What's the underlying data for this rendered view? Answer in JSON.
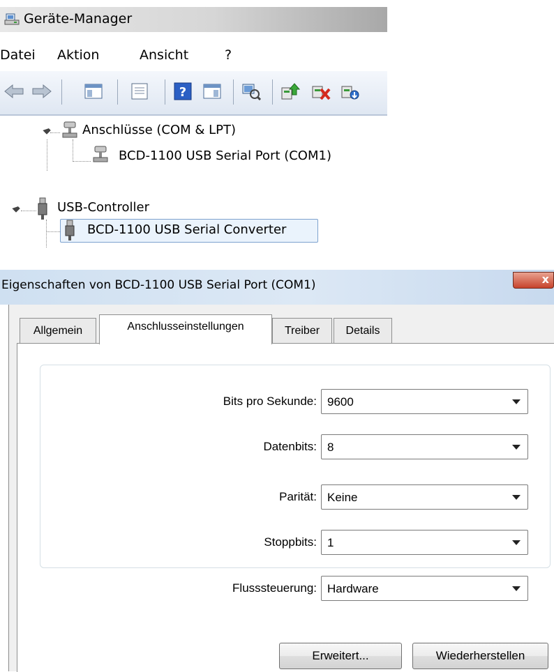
{
  "device_manager": {
    "title": "Geräte-Manager",
    "menu": [
      "Datei",
      "Aktion",
      "Ansicht",
      "?"
    ],
    "toolbar": [
      {
        "name": "back-icon"
      },
      {
        "name": "forward-icon"
      },
      {
        "name": "show-hide-console-tree-icon"
      },
      {
        "name": "properties-icon"
      },
      {
        "name": "help-icon"
      },
      {
        "name": "action-pane-icon"
      },
      {
        "name": "scan-hardware-icon"
      },
      {
        "name": "update-driver-icon"
      },
      {
        "name": "uninstall-device-icon"
      },
      {
        "name": "enable-device-icon"
      }
    ],
    "tree": {
      "ports_category": "Anschlüsse (COM & LPT)",
      "ports_child": "BCD-1100 USB Serial Port (COM1)",
      "usb_category": "USB-Controller",
      "usb_child": "BCD-1100 USB Serial Converter"
    }
  },
  "dialog": {
    "title": "Eigenschaften von BCD-1100 USB Serial Port (COM1)",
    "close": "x",
    "tabs": [
      "Allgemein",
      "Anschlusseinstellungen",
      "Treiber",
      "Details"
    ],
    "active_tab": "Anschlusseinstellungen",
    "settings": {
      "baud": {
        "label": "Bits pro Sekunde:",
        "value": "9600"
      },
      "databits": {
        "label": "Datenbits:",
        "value": "8"
      },
      "parity": {
        "label": "Parität:",
        "value": "Keine"
      },
      "stopbits": {
        "label": "Stoppbits:",
        "value": "1"
      },
      "flow": {
        "label": "Flusssteuerung:",
        "value": "Hardware"
      }
    },
    "buttons": {
      "advanced": "Erweitert...",
      "restore": "Wiederherstellen"
    }
  }
}
